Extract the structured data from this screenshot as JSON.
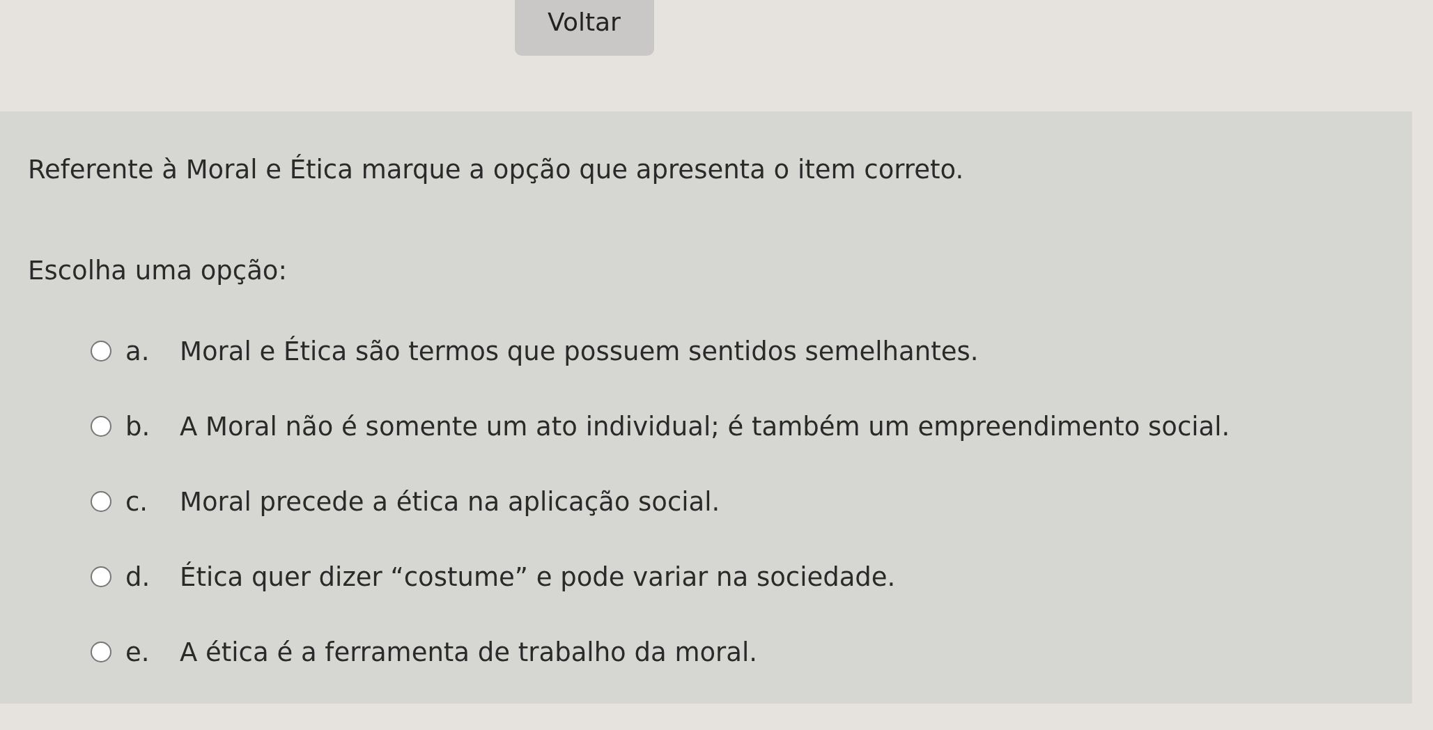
{
  "back_button": {
    "label": "Voltar"
  },
  "question": {
    "text": "Referente à Moral e Ética marque a opção que apresenta o item correto.",
    "prompt": "Escolha uma opção:",
    "options": [
      {
        "letter": "a.",
        "text": "Moral e Ética são termos que possuem sentidos semelhantes.",
        "selected": false
      },
      {
        "letter": "b.",
        "text": "A Moral não é somente um ato individual; é também um empreendimento social.",
        "selected": false
      },
      {
        "letter": "c.",
        "text": "Moral precede a ética na aplicação social.",
        "selected": false
      },
      {
        "letter": "d.",
        "text": "Ética quer dizer “costume” e pode variar na sociedade.",
        "selected": false
      },
      {
        "letter": "e.",
        "text": "A ética é a ferramenta de trabalho da moral.",
        "selected": false
      }
    ]
  }
}
